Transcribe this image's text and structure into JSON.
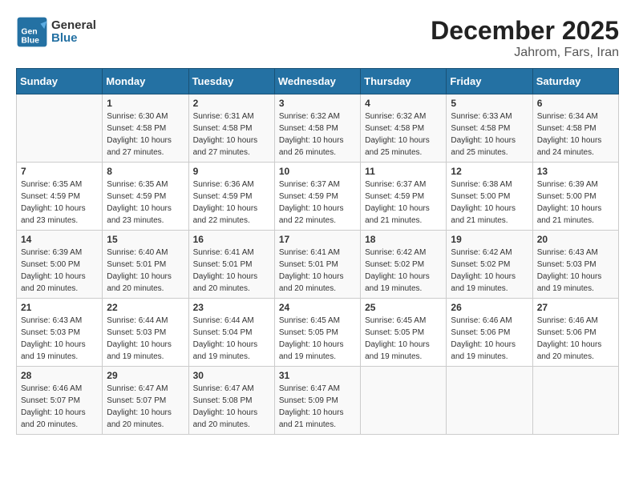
{
  "header": {
    "logo_general": "General",
    "logo_blue": "Blue",
    "month_title": "December 2025",
    "subtitle": "Jahrom, Fars, Iran"
  },
  "calendar": {
    "weekdays": [
      "Sunday",
      "Monday",
      "Tuesday",
      "Wednesday",
      "Thursday",
      "Friday",
      "Saturday"
    ],
    "weeks": [
      [
        {
          "day": "",
          "info": ""
        },
        {
          "day": "1",
          "info": "Sunrise: 6:30 AM\nSunset: 4:58 PM\nDaylight: 10 hours\nand 27 minutes."
        },
        {
          "day": "2",
          "info": "Sunrise: 6:31 AM\nSunset: 4:58 PM\nDaylight: 10 hours\nand 27 minutes."
        },
        {
          "day": "3",
          "info": "Sunrise: 6:32 AM\nSunset: 4:58 PM\nDaylight: 10 hours\nand 26 minutes."
        },
        {
          "day": "4",
          "info": "Sunrise: 6:32 AM\nSunset: 4:58 PM\nDaylight: 10 hours\nand 25 minutes."
        },
        {
          "day": "5",
          "info": "Sunrise: 6:33 AM\nSunset: 4:58 PM\nDaylight: 10 hours\nand 25 minutes."
        },
        {
          "day": "6",
          "info": "Sunrise: 6:34 AM\nSunset: 4:58 PM\nDaylight: 10 hours\nand 24 minutes."
        }
      ],
      [
        {
          "day": "7",
          "info": "Sunrise: 6:35 AM\nSunset: 4:59 PM\nDaylight: 10 hours\nand 23 minutes."
        },
        {
          "day": "8",
          "info": "Sunrise: 6:35 AM\nSunset: 4:59 PM\nDaylight: 10 hours\nand 23 minutes."
        },
        {
          "day": "9",
          "info": "Sunrise: 6:36 AM\nSunset: 4:59 PM\nDaylight: 10 hours\nand 22 minutes."
        },
        {
          "day": "10",
          "info": "Sunrise: 6:37 AM\nSunset: 4:59 PM\nDaylight: 10 hours\nand 22 minutes."
        },
        {
          "day": "11",
          "info": "Sunrise: 6:37 AM\nSunset: 4:59 PM\nDaylight: 10 hours\nand 21 minutes."
        },
        {
          "day": "12",
          "info": "Sunrise: 6:38 AM\nSunset: 5:00 PM\nDaylight: 10 hours\nand 21 minutes."
        },
        {
          "day": "13",
          "info": "Sunrise: 6:39 AM\nSunset: 5:00 PM\nDaylight: 10 hours\nand 21 minutes."
        }
      ],
      [
        {
          "day": "14",
          "info": "Sunrise: 6:39 AM\nSunset: 5:00 PM\nDaylight: 10 hours\nand 20 minutes."
        },
        {
          "day": "15",
          "info": "Sunrise: 6:40 AM\nSunset: 5:01 PM\nDaylight: 10 hours\nand 20 minutes."
        },
        {
          "day": "16",
          "info": "Sunrise: 6:41 AM\nSunset: 5:01 PM\nDaylight: 10 hours\nand 20 minutes."
        },
        {
          "day": "17",
          "info": "Sunrise: 6:41 AM\nSunset: 5:01 PM\nDaylight: 10 hours\nand 20 minutes."
        },
        {
          "day": "18",
          "info": "Sunrise: 6:42 AM\nSunset: 5:02 PM\nDaylight: 10 hours\nand 19 minutes."
        },
        {
          "day": "19",
          "info": "Sunrise: 6:42 AM\nSunset: 5:02 PM\nDaylight: 10 hours\nand 19 minutes."
        },
        {
          "day": "20",
          "info": "Sunrise: 6:43 AM\nSunset: 5:03 PM\nDaylight: 10 hours\nand 19 minutes."
        }
      ],
      [
        {
          "day": "21",
          "info": "Sunrise: 6:43 AM\nSunset: 5:03 PM\nDaylight: 10 hours\nand 19 minutes."
        },
        {
          "day": "22",
          "info": "Sunrise: 6:44 AM\nSunset: 5:03 PM\nDaylight: 10 hours\nand 19 minutes."
        },
        {
          "day": "23",
          "info": "Sunrise: 6:44 AM\nSunset: 5:04 PM\nDaylight: 10 hours\nand 19 minutes."
        },
        {
          "day": "24",
          "info": "Sunrise: 6:45 AM\nSunset: 5:05 PM\nDaylight: 10 hours\nand 19 minutes."
        },
        {
          "day": "25",
          "info": "Sunrise: 6:45 AM\nSunset: 5:05 PM\nDaylight: 10 hours\nand 19 minutes."
        },
        {
          "day": "26",
          "info": "Sunrise: 6:46 AM\nSunset: 5:06 PM\nDaylight: 10 hours\nand 19 minutes."
        },
        {
          "day": "27",
          "info": "Sunrise: 6:46 AM\nSunset: 5:06 PM\nDaylight: 10 hours\nand 20 minutes."
        }
      ],
      [
        {
          "day": "28",
          "info": "Sunrise: 6:46 AM\nSunset: 5:07 PM\nDaylight: 10 hours\nand 20 minutes."
        },
        {
          "day": "29",
          "info": "Sunrise: 6:47 AM\nSunset: 5:07 PM\nDaylight: 10 hours\nand 20 minutes."
        },
        {
          "day": "30",
          "info": "Sunrise: 6:47 AM\nSunset: 5:08 PM\nDaylight: 10 hours\nand 20 minutes."
        },
        {
          "day": "31",
          "info": "Sunrise: 6:47 AM\nSunset: 5:09 PM\nDaylight: 10 hours\nand 21 minutes."
        },
        {
          "day": "",
          "info": ""
        },
        {
          "day": "",
          "info": ""
        },
        {
          "day": "",
          "info": ""
        }
      ]
    ]
  }
}
